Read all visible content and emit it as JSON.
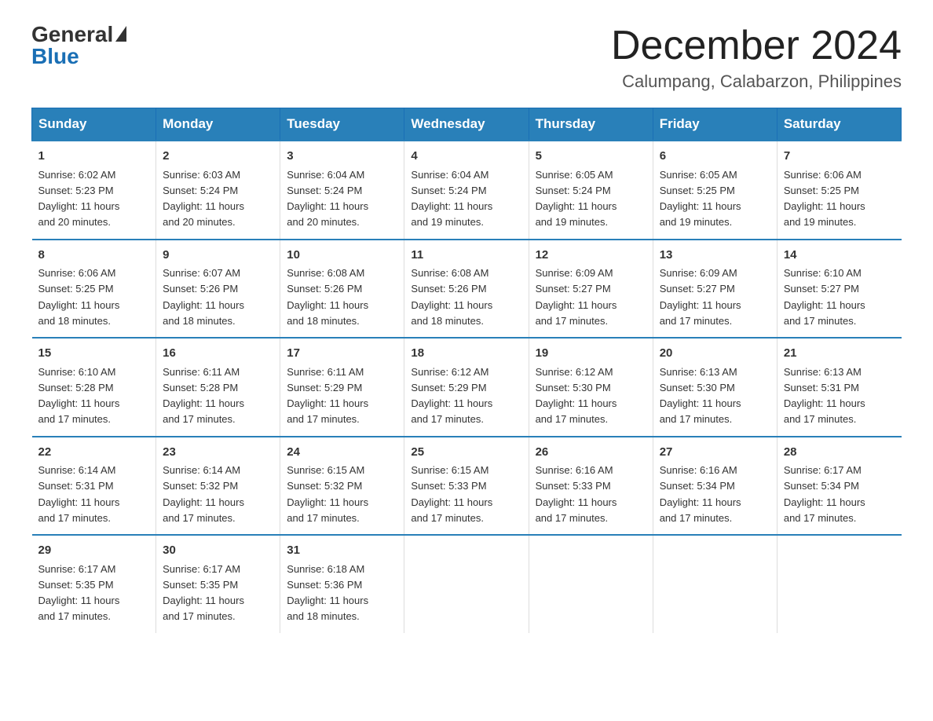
{
  "logo": {
    "general": "General",
    "blue": "Blue"
  },
  "title": "December 2024",
  "subtitle": "Calumpang, Calabarzon, Philippines",
  "days_header": [
    "Sunday",
    "Monday",
    "Tuesday",
    "Wednesday",
    "Thursday",
    "Friday",
    "Saturday"
  ],
  "weeks": [
    [
      {
        "num": "1",
        "sunrise": "6:02 AM",
        "sunset": "5:23 PM",
        "daylight": "11 hours and 20 minutes."
      },
      {
        "num": "2",
        "sunrise": "6:03 AM",
        "sunset": "5:24 PM",
        "daylight": "11 hours and 20 minutes."
      },
      {
        "num": "3",
        "sunrise": "6:04 AM",
        "sunset": "5:24 PM",
        "daylight": "11 hours and 20 minutes."
      },
      {
        "num": "4",
        "sunrise": "6:04 AM",
        "sunset": "5:24 PM",
        "daylight": "11 hours and 19 minutes."
      },
      {
        "num": "5",
        "sunrise": "6:05 AM",
        "sunset": "5:24 PM",
        "daylight": "11 hours and 19 minutes."
      },
      {
        "num": "6",
        "sunrise": "6:05 AM",
        "sunset": "5:25 PM",
        "daylight": "11 hours and 19 minutes."
      },
      {
        "num": "7",
        "sunrise": "6:06 AM",
        "sunset": "5:25 PM",
        "daylight": "11 hours and 19 minutes."
      }
    ],
    [
      {
        "num": "8",
        "sunrise": "6:06 AM",
        "sunset": "5:25 PM",
        "daylight": "11 hours and 18 minutes."
      },
      {
        "num": "9",
        "sunrise": "6:07 AM",
        "sunset": "5:26 PM",
        "daylight": "11 hours and 18 minutes."
      },
      {
        "num": "10",
        "sunrise": "6:08 AM",
        "sunset": "5:26 PM",
        "daylight": "11 hours and 18 minutes."
      },
      {
        "num": "11",
        "sunrise": "6:08 AM",
        "sunset": "5:26 PM",
        "daylight": "11 hours and 18 minutes."
      },
      {
        "num": "12",
        "sunrise": "6:09 AM",
        "sunset": "5:27 PM",
        "daylight": "11 hours and 17 minutes."
      },
      {
        "num": "13",
        "sunrise": "6:09 AM",
        "sunset": "5:27 PM",
        "daylight": "11 hours and 17 minutes."
      },
      {
        "num": "14",
        "sunrise": "6:10 AM",
        "sunset": "5:27 PM",
        "daylight": "11 hours and 17 minutes."
      }
    ],
    [
      {
        "num": "15",
        "sunrise": "6:10 AM",
        "sunset": "5:28 PM",
        "daylight": "11 hours and 17 minutes."
      },
      {
        "num": "16",
        "sunrise": "6:11 AM",
        "sunset": "5:28 PM",
        "daylight": "11 hours and 17 minutes."
      },
      {
        "num": "17",
        "sunrise": "6:11 AM",
        "sunset": "5:29 PM",
        "daylight": "11 hours and 17 minutes."
      },
      {
        "num": "18",
        "sunrise": "6:12 AM",
        "sunset": "5:29 PM",
        "daylight": "11 hours and 17 minutes."
      },
      {
        "num": "19",
        "sunrise": "6:12 AM",
        "sunset": "5:30 PM",
        "daylight": "11 hours and 17 minutes."
      },
      {
        "num": "20",
        "sunrise": "6:13 AM",
        "sunset": "5:30 PM",
        "daylight": "11 hours and 17 minutes."
      },
      {
        "num": "21",
        "sunrise": "6:13 AM",
        "sunset": "5:31 PM",
        "daylight": "11 hours and 17 minutes."
      }
    ],
    [
      {
        "num": "22",
        "sunrise": "6:14 AM",
        "sunset": "5:31 PM",
        "daylight": "11 hours and 17 minutes."
      },
      {
        "num": "23",
        "sunrise": "6:14 AM",
        "sunset": "5:32 PM",
        "daylight": "11 hours and 17 minutes."
      },
      {
        "num": "24",
        "sunrise": "6:15 AM",
        "sunset": "5:32 PM",
        "daylight": "11 hours and 17 minutes."
      },
      {
        "num": "25",
        "sunrise": "6:15 AM",
        "sunset": "5:33 PM",
        "daylight": "11 hours and 17 minutes."
      },
      {
        "num": "26",
        "sunrise": "6:16 AM",
        "sunset": "5:33 PM",
        "daylight": "11 hours and 17 minutes."
      },
      {
        "num": "27",
        "sunrise": "6:16 AM",
        "sunset": "5:34 PM",
        "daylight": "11 hours and 17 minutes."
      },
      {
        "num": "28",
        "sunrise": "6:17 AM",
        "sunset": "5:34 PM",
        "daylight": "11 hours and 17 minutes."
      }
    ],
    [
      {
        "num": "29",
        "sunrise": "6:17 AM",
        "sunset": "5:35 PM",
        "daylight": "11 hours and 17 minutes."
      },
      {
        "num": "30",
        "sunrise": "6:17 AM",
        "sunset": "5:35 PM",
        "daylight": "11 hours and 17 minutes."
      },
      {
        "num": "31",
        "sunrise": "6:18 AM",
        "sunset": "5:36 PM",
        "daylight": "11 hours and 18 minutes."
      },
      null,
      null,
      null,
      null
    ]
  ]
}
